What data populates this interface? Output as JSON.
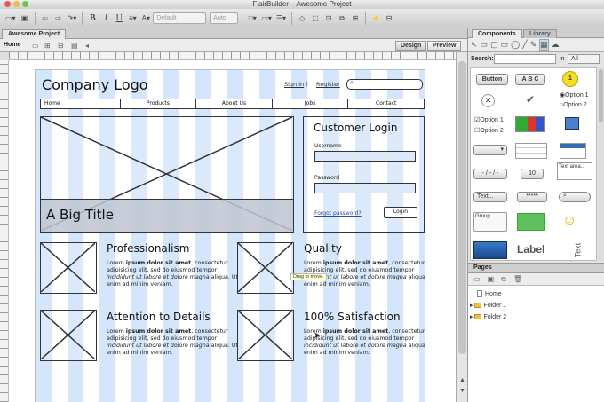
{
  "window": {
    "title": "FlairBuilder  – Awesome Project"
  },
  "toolbar": {
    "font_select": "Default",
    "size_select": "Auto",
    "icons": [
      "new-icon",
      "save-icon",
      "undo-icon",
      "redo-icon",
      "cut-icon",
      "bold-icon",
      "italic-icon",
      "underline-icon",
      "align-icon",
      "text-color-icon",
      "fill-color-icon",
      "border-icon",
      "line-icon",
      "arrange-icon",
      "shape-icon",
      "group-icon",
      "lock-icon",
      "preview-icon",
      "settings-icon",
      "bolt-icon",
      "export-icon"
    ],
    "bold": "B",
    "italic": "I",
    "underline": "U"
  },
  "project_tab": "Awesome Project",
  "pagebar": {
    "page": "Home",
    "design": "Design",
    "preview": "Preview"
  },
  "mockup": {
    "logo": "Company Logo",
    "sign_in": "Sign in",
    "register": "Register",
    "nav": [
      "Home",
      "Products",
      "About Us",
      "Jobs",
      "Contact"
    ],
    "hero_title": "A Big Title",
    "login": {
      "title": "Customer Login",
      "username": "Username",
      "password": "Password",
      "forgot": "Forgot password?",
      "button": "Login"
    },
    "features": [
      {
        "title": "Professionalism"
      },
      {
        "title": "Quality"
      },
      {
        "title": "Attention to Details"
      },
      {
        "title": "100% Satisfaction"
      }
    ],
    "lorem": {
      "a": "Lorem ",
      "b": "ipsum dolor sit amet",
      "c": ", consectetur adipisicing elit, sed do eiusmod tempor ",
      "d": "incididunt ut labore et dolore magna",
      "e": " aliqua. Ut enim ad minim veniam."
    },
    "tooltip": "Drag to move."
  },
  "right_panel": {
    "tabs": [
      "Components",
      "Library"
    ],
    "search_label": "Search:",
    "in_label": "in",
    "scope": "All",
    "components": {
      "button": "Button",
      "abc": "A B C",
      "badge": "1",
      "option1": "Option 1",
      "option2": "Option 2",
      "dates": "- / - / -",
      "stepper": "10",
      "textarea": "Text area...",
      "textinput": "Text...",
      "password": "*****",
      "group": "Group",
      "label": "Label",
      "text": "Text"
    },
    "pages_title": "Pages",
    "pages": [
      "Home",
      "Folder 1",
      "Folder 2"
    ]
  },
  "colors": {
    "grid_blue": "#d4e6fb",
    "link": "#2a4fa0",
    "badge": "#f0e020"
  }
}
